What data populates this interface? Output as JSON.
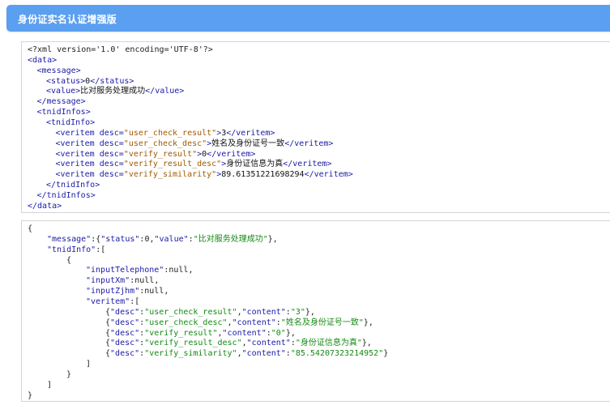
{
  "header": {
    "title": "身份证实名认证增强版"
  },
  "xml_panel": {
    "lines": [
      {
        "i": 0,
        "t": [
          [
            "punct",
            "<?xml version='1.0' encoding='UTF-8'?>"
          ]
        ]
      },
      {
        "i": 0,
        "t": [
          [
            "tag",
            "<data>"
          ]
        ]
      },
      {
        "i": 1,
        "t": [
          [
            "tag",
            "<message>"
          ]
        ]
      },
      {
        "i": 2,
        "t": [
          [
            "tag",
            "<status>"
          ],
          [
            "text",
            "0"
          ],
          [
            "tag",
            "</status>"
          ]
        ]
      },
      {
        "i": 2,
        "t": [
          [
            "tag",
            "<value>"
          ],
          [
            "text",
            "比对服务处理成功"
          ],
          [
            "tag",
            "</value>"
          ]
        ]
      },
      {
        "i": 1,
        "t": [
          [
            "tag",
            "</message>"
          ]
        ]
      },
      {
        "i": 1,
        "t": [
          [
            "tag",
            "<tnidInfos>"
          ]
        ]
      },
      {
        "i": 2,
        "t": [
          [
            "tag",
            "<tnidInfo>"
          ]
        ]
      },
      {
        "i": 3,
        "t": [
          [
            "tag",
            "<veritem "
          ],
          [
            "attr",
            "desc="
          ],
          [
            "val",
            "\"user_check_result\""
          ],
          [
            "tag",
            ">"
          ],
          [
            "text",
            "3"
          ],
          [
            "tag",
            "</veritem>"
          ]
        ]
      },
      {
        "i": 3,
        "t": [
          [
            "tag",
            "<veritem "
          ],
          [
            "attr",
            "desc="
          ],
          [
            "val",
            "\"user_check_desc\""
          ],
          [
            "tag",
            ">"
          ],
          [
            "text",
            "姓名及身份证号一致"
          ],
          [
            "tag",
            "</veritem>"
          ]
        ]
      },
      {
        "i": 3,
        "t": [
          [
            "tag",
            "<veritem "
          ],
          [
            "attr",
            "desc="
          ],
          [
            "val",
            "\"verify_result\""
          ],
          [
            "tag",
            ">"
          ],
          [
            "text",
            "0"
          ],
          [
            "tag",
            "</veritem>"
          ]
        ]
      },
      {
        "i": 3,
        "t": [
          [
            "tag",
            "<veritem "
          ],
          [
            "attr",
            "desc="
          ],
          [
            "val",
            "\"verify_result_desc\""
          ],
          [
            "tag",
            ">"
          ],
          [
            "text",
            "身份证信息为真"
          ],
          [
            "tag",
            "</veritem>"
          ]
        ]
      },
      {
        "i": 3,
        "t": [
          [
            "tag",
            "<veritem "
          ],
          [
            "attr",
            "desc="
          ],
          [
            "val",
            "\"verify_similarity\""
          ],
          [
            "tag",
            ">"
          ],
          [
            "text",
            "89.61351221698294"
          ],
          [
            "tag",
            "</veritem>"
          ]
        ]
      },
      {
        "i": 2,
        "t": [
          [
            "tag",
            "</tnidInfo>"
          ]
        ]
      },
      {
        "i": 1,
        "t": [
          [
            "tag",
            "</tnidInfos>"
          ]
        ]
      },
      {
        "i": 0,
        "t": [
          [
            "tag",
            "</data>"
          ]
        ]
      }
    ]
  },
  "json_panel": {
    "lines": [
      {
        "i": 0,
        "t": [
          [
            "punct",
            "{"
          ]
        ]
      },
      {
        "i": 1,
        "t": [
          [
            "key",
            "\"message\""
          ],
          [
            "punct",
            ":{"
          ],
          [
            "key",
            "\"status\""
          ],
          [
            "punct",
            ":"
          ],
          [
            "lit",
            "0"
          ],
          [
            "punct",
            ","
          ],
          [
            "key",
            "\"value\""
          ],
          [
            "punct",
            ":"
          ],
          [
            "str",
            "\"比对服务处理成功\""
          ],
          [
            "punct",
            "},"
          ]
        ]
      },
      {
        "i": 1,
        "t": [
          [
            "key",
            "\"tnidInfo\""
          ],
          [
            "punct",
            ":["
          ]
        ]
      },
      {
        "i": 2,
        "t": [
          [
            "punct",
            "{"
          ]
        ]
      },
      {
        "i": 3,
        "t": [
          [
            "key",
            "\"inputTelephone\""
          ],
          [
            "punct",
            ":"
          ],
          [
            "lit",
            "null"
          ],
          [
            "punct",
            ","
          ]
        ]
      },
      {
        "i": 3,
        "t": [
          [
            "key",
            "\"inputXm\""
          ],
          [
            "punct",
            ":"
          ],
          [
            "lit",
            "null"
          ],
          [
            "punct",
            ","
          ]
        ]
      },
      {
        "i": 3,
        "t": [
          [
            "key",
            "\"inputZjhm\""
          ],
          [
            "punct",
            ":"
          ],
          [
            "lit",
            "null"
          ],
          [
            "punct",
            ","
          ]
        ]
      },
      {
        "i": 3,
        "t": [
          [
            "key",
            "\"veritem\""
          ],
          [
            "punct",
            ":["
          ]
        ]
      },
      {
        "i": 4,
        "t": [
          [
            "punct",
            "{"
          ],
          [
            "key",
            "\"desc\""
          ],
          [
            "punct",
            ":"
          ],
          [
            "str",
            "\"user_check_result\""
          ],
          [
            "punct",
            ","
          ],
          [
            "key",
            "\"content\""
          ],
          [
            "punct",
            ":"
          ],
          [
            "str",
            "\"3\""
          ],
          [
            "punct",
            "},"
          ]
        ]
      },
      {
        "i": 4,
        "t": [
          [
            "punct",
            "{"
          ],
          [
            "key",
            "\"desc\""
          ],
          [
            "punct",
            ":"
          ],
          [
            "str",
            "\"user_check_desc\""
          ],
          [
            "punct",
            ","
          ],
          [
            "key",
            "\"content\""
          ],
          [
            "punct",
            ":"
          ],
          [
            "str",
            "\"姓名及身份证号一致\""
          ],
          [
            "punct",
            "},"
          ]
        ]
      },
      {
        "i": 4,
        "t": [
          [
            "punct",
            "{"
          ],
          [
            "key",
            "\"desc\""
          ],
          [
            "punct",
            ":"
          ],
          [
            "str",
            "\"verify_result\""
          ],
          [
            "punct",
            ","
          ],
          [
            "key",
            "\"content\""
          ],
          [
            "punct",
            ":"
          ],
          [
            "str",
            "\"0\""
          ],
          [
            "punct",
            "},"
          ]
        ]
      },
      {
        "i": 4,
        "t": [
          [
            "punct",
            "{"
          ],
          [
            "key",
            "\"desc\""
          ],
          [
            "punct",
            ":"
          ],
          [
            "str",
            "\"verify_result_desc\""
          ],
          [
            "punct",
            ","
          ],
          [
            "key",
            "\"content\""
          ],
          [
            "punct",
            ":"
          ],
          [
            "str",
            "\"身份证信息为真\""
          ],
          [
            "punct",
            "},"
          ]
        ]
      },
      {
        "i": 4,
        "t": [
          [
            "punct",
            "{"
          ],
          [
            "key",
            "\"desc\""
          ],
          [
            "punct",
            ":"
          ],
          [
            "str",
            "\"verify_similarity\""
          ],
          [
            "punct",
            ","
          ],
          [
            "key",
            "\"content\""
          ],
          [
            "punct",
            ":"
          ],
          [
            "str",
            "\"85.54207323214952\""
          ],
          [
            "punct",
            "}"
          ]
        ]
      },
      {
        "i": 3,
        "t": [
          [
            "punct",
            "]"
          ]
        ]
      },
      {
        "i": 2,
        "t": [
          [
            "punct",
            "}"
          ]
        ]
      },
      {
        "i": 1,
        "t": [
          [
            "punct",
            "]"
          ]
        ]
      },
      {
        "i": 0,
        "t": [
          [
            "punct",
            "}"
          ]
        ]
      }
    ]
  }
}
